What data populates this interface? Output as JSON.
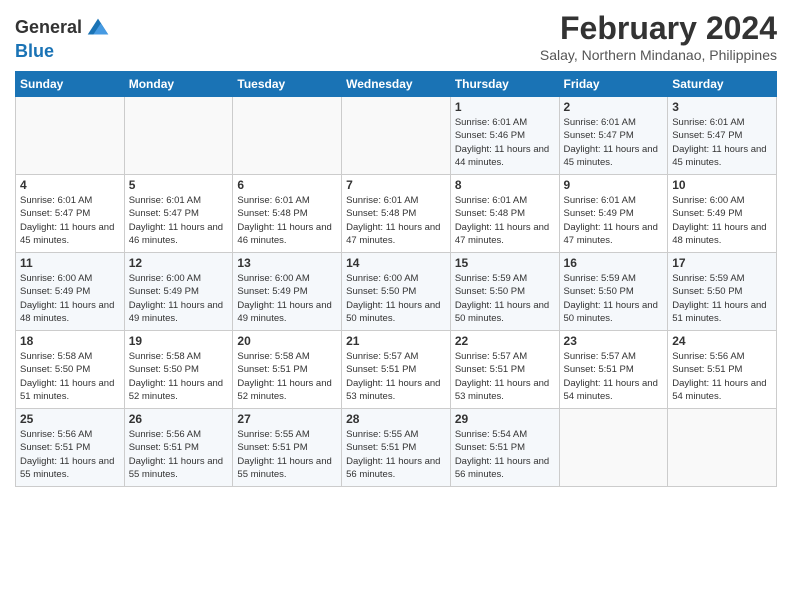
{
  "header": {
    "logo_line1": "General",
    "logo_line2": "Blue",
    "month_year": "February 2024",
    "location": "Salay, Northern Mindanao, Philippines"
  },
  "weekdays": [
    "Sunday",
    "Monday",
    "Tuesday",
    "Wednesday",
    "Thursday",
    "Friday",
    "Saturday"
  ],
  "weeks": [
    [
      {
        "day": "",
        "empty": true
      },
      {
        "day": "",
        "empty": true
      },
      {
        "day": "",
        "empty": true
      },
      {
        "day": "",
        "empty": true
      },
      {
        "day": "1",
        "sunrise": "6:01 AM",
        "sunset": "5:46 PM",
        "daylight": "11 hours and 44 minutes."
      },
      {
        "day": "2",
        "sunrise": "6:01 AM",
        "sunset": "5:47 PM",
        "daylight": "11 hours and 45 minutes."
      },
      {
        "day": "3",
        "sunrise": "6:01 AM",
        "sunset": "5:47 PM",
        "daylight": "11 hours and 45 minutes."
      }
    ],
    [
      {
        "day": "4",
        "sunrise": "6:01 AM",
        "sunset": "5:47 PM",
        "daylight": "11 hours and 45 minutes."
      },
      {
        "day": "5",
        "sunrise": "6:01 AM",
        "sunset": "5:47 PM",
        "daylight": "11 hours and 46 minutes."
      },
      {
        "day": "6",
        "sunrise": "6:01 AM",
        "sunset": "5:48 PM",
        "daylight": "11 hours and 46 minutes."
      },
      {
        "day": "7",
        "sunrise": "6:01 AM",
        "sunset": "5:48 PM",
        "daylight": "11 hours and 47 minutes."
      },
      {
        "day": "8",
        "sunrise": "6:01 AM",
        "sunset": "5:48 PM",
        "daylight": "11 hours and 47 minutes."
      },
      {
        "day": "9",
        "sunrise": "6:01 AM",
        "sunset": "5:49 PM",
        "daylight": "11 hours and 47 minutes."
      },
      {
        "day": "10",
        "sunrise": "6:00 AM",
        "sunset": "5:49 PM",
        "daylight": "11 hours and 48 minutes."
      }
    ],
    [
      {
        "day": "11",
        "sunrise": "6:00 AM",
        "sunset": "5:49 PM",
        "daylight": "11 hours and 48 minutes."
      },
      {
        "day": "12",
        "sunrise": "6:00 AM",
        "sunset": "5:49 PM",
        "daylight": "11 hours and 49 minutes."
      },
      {
        "day": "13",
        "sunrise": "6:00 AM",
        "sunset": "5:49 PM",
        "daylight": "11 hours and 49 minutes."
      },
      {
        "day": "14",
        "sunrise": "6:00 AM",
        "sunset": "5:50 PM",
        "daylight": "11 hours and 50 minutes."
      },
      {
        "day": "15",
        "sunrise": "5:59 AM",
        "sunset": "5:50 PM",
        "daylight": "11 hours and 50 minutes."
      },
      {
        "day": "16",
        "sunrise": "5:59 AM",
        "sunset": "5:50 PM",
        "daylight": "11 hours and 50 minutes."
      },
      {
        "day": "17",
        "sunrise": "5:59 AM",
        "sunset": "5:50 PM",
        "daylight": "11 hours and 51 minutes."
      }
    ],
    [
      {
        "day": "18",
        "sunrise": "5:58 AM",
        "sunset": "5:50 PM",
        "daylight": "11 hours and 51 minutes."
      },
      {
        "day": "19",
        "sunrise": "5:58 AM",
        "sunset": "5:50 PM",
        "daylight": "11 hours and 52 minutes."
      },
      {
        "day": "20",
        "sunrise": "5:58 AM",
        "sunset": "5:51 PM",
        "daylight": "11 hours and 52 minutes."
      },
      {
        "day": "21",
        "sunrise": "5:57 AM",
        "sunset": "5:51 PM",
        "daylight": "11 hours and 53 minutes."
      },
      {
        "day": "22",
        "sunrise": "5:57 AM",
        "sunset": "5:51 PM",
        "daylight": "11 hours and 53 minutes."
      },
      {
        "day": "23",
        "sunrise": "5:57 AM",
        "sunset": "5:51 PM",
        "daylight": "11 hours and 54 minutes."
      },
      {
        "day": "24",
        "sunrise": "5:56 AM",
        "sunset": "5:51 PM",
        "daylight": "11 hours and 54 minutes."
      }
    ],
    [
      {
        "day": "25",
        "sunrise": "5:56 AM",
        "sunset": "5:51 PM",
        "daylight": "11 hours and 55 minutes."
      },
      {
        "day": "26",
        "sunrise": "5:56 AM",
        "sunset": "5:51 PM",
        "daylight": "11 hours and 55 minutes."
      },
      {
        "day": "27",
        "sunrise": "5:55 AM",
        "sunset": "5:51 PM",
        "daylight": "11 hours and 55 minutes."
      },
      {
        "day": "28",
        "sunrise": "5:55 AM",
        "sunset": "5:51 PM",
        "daylight": "11 hours and 56 minutes."
      },
      {
        "day": "29",
        "sunrise": "5:54 AM",
        "sunset": "5:51 PM",
        "daylight": "11 hours and 56 minutes."
      },
      {
        "day": "",
        "empty": true
      },
      {
        "day": "",
        "empty": true
      }
    ]
  ]
}
